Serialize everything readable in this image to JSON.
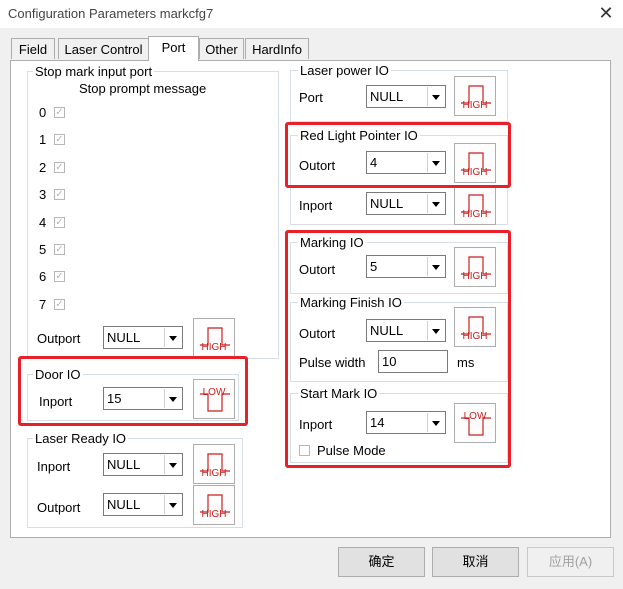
{
  "window": {
    "title": "Configuration Parameters markcfg7",
    "close_glyph": "✕"
  },
  "tabs": [
    "Field",
    "Laser Control",
    "Port",
    "Other",
    "HardInfo"
  ],
  "active_tab": "Port",
  "stop_mark": {
    "title": "Stop mark input port",
    "subtitle": "Stop prompt message",
    "rows": [
      {
        "label": "0",
        "checked": true
      },
      {
        "label": "1",
        "checked": true
      },
      {
        "label": "2",
        "checked": true
      },
      {
        "label": "3",
        "checked": true
      },
      {
        "label": "4",
        "checked": true
      },
      {
        "label": "5",
        "checked": true
      },
      {
        "label": "6",
        "checked": true
      },
      {
        "label": "7",
        "checked": true
      }
    ],
    "outport_label": "Outport",
    "outport_value": "NULL",
    "outport_level": "HIGH"
  },
  "door_io": {
    "title": "Door IO",
    "inport_label": "Inport",
    "inport_value": "15",
    "level": "LOW"
  },
  "laser_ready_io": {
    "title": "Laser Ready IO",
    "inport_label": "Inport",
    "inport_value": "NULL",
    "inport_level": "HIGH",
    "outport_label": "Outport",
    "outport_value": "NULL",
    "outport_level": "HIGH"
  },
  "laser_power_io": {
    "title": "Laser power IO",
    "port_label": "Port",
    "port_value": "NULL",
    "level": "HIGH"
  },
  "red_light_io": {
    "title": "Red Light Pointer IO",
    "outport_label": "Outort",
    "outport_value": "4",
    "outport_level": "HIGH",
    "inport_label": "Inport",
    "inport_value": "NULL",
    "inport_level": "HIGH"
  },
  "marking_io": {
    "title": "Marking IO",
    "outport_label": "Outort",
    "outport_value": "5",
    "level": "HIGH"
  },
  "marking_finish_io": {
    "title": "Marking Finish IO",
    "outport_label": "Outort",
    "outport_value": "NULL",
    "level": "HIGH",
    "pulse_width_label": "Pulse width",
    "pulse_width_value": "10",
    "pulse_width_unit": "ms"
  },
  "start_mark_io": {
    "title": "Start Mark IO",
    "inport_label": "Inport",
    "inport_value": "14",
    "level": "LOW",
    "pulse_mode_label": "Pulse Mode",
    "pulse_mode_checked": false
  },
  "buttons": {
    "ok": "确定",
    "cancel": "取消",
    "apply": "应用(A)"
  },
  "colors": {
    "highlight": "#e8202a",
    "io_signal": "#cc2020"
  }
}
